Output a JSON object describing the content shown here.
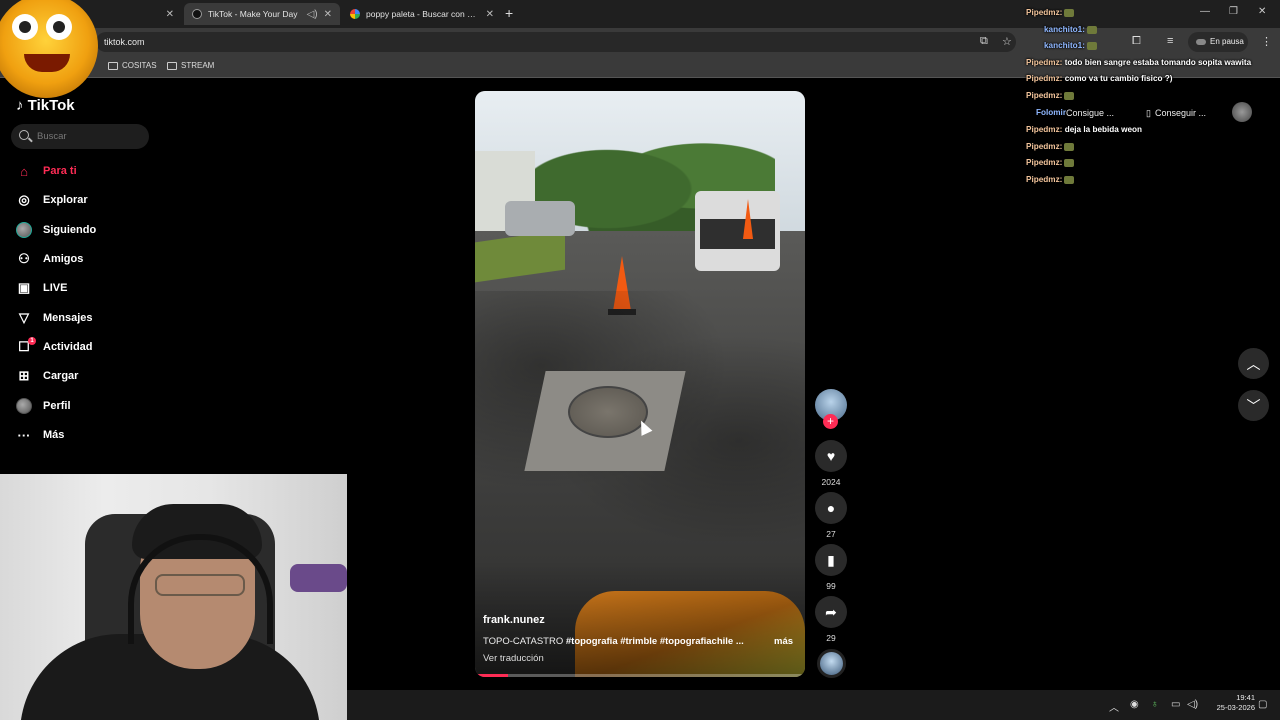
{
  "browser": {
    "tabs": [
      {
        "title": "",
        "active": false
      },
      {
        "title": "TikTok - Make Your Day",
        "active": true
      },
      {
        "title": "poppy paleta - Buscar con Goo",
        "active": false
      }
    ],
    "url": "tiktok.com",
    "media_pill": "En pausa",
    "bookmarks": [
      "COSITAS",
      "STREAM"
    ]
  },
  "sidebar": {
    "logo": "TikTok",
    "search_placeholder": "Buscar",
    "items": [
      {
        "label": "Para ti",
        "icon": "home-icon"
      },
      {
        "label": "Explorar",
        "icon": "compass-icon"
      },
      {
        "label": "Siguiendo",
        "icon": "avatar-icon"
      },
      {
        "label": "Amigos",
        "icon": "friends-icon"
      },
      {
        "label": "LIVE",
        "icon": "live-icon"
      },
      {
        "label": "Mensajes",
        "icon": "messages-icon"
      },
      {
        "label": "Actividad",
        "icon": "activity-icon",
        "badge": "1"
      },
      {
        "label": "Cargar",
        "icon": "upload-icon"
      },
      {
        "label": "Perfil",
        "icon": "profile-icon"
      },
      {
        "label": "Más",
        "icon": "more-icon"
      }
    ]
  },
  "video": {
    "author": "frank.nunez",
    "caption_prefix": "TOPO-CATASTRO",
    "hashtags": "#topografia #trimble #topografiachile ...",
    "more": "más",
    "translate": "Ver traducción",
    "progress": 0.1
  },
  "actions": {
    "likes": "2024",
    "comments": "27",
    "saves": "99",
    "shares": "29"
  },
  "topright": {
    "get1": "Consigue ...",
    "get2": "Conseguir ..."
  },
  "chat": [
    {
      "user": "Pipedmz:",
      "msg": "",
      "color": "orange"
    },
    {
      "user": "kanchito1:",
      "msg": "",
      "color": "blue"
    },
    {
      "user": "kanchito1:",
      "msg": "",
      "color": "blue"
    },
    {
      "user": "Pipedmz:",
      "msg": "todo bien sangre estaba tomando sopita wawita",
      "color": "orange"
    },
    {
      "user": "Pipedmz:",
      "msg": "como va tu cambio fisico ?)",
      "color": "orange"
    },
    {
      "user": "Pipedmz:",
      "msg": "",
      "color": "orange"
    },
    {
      "user": "Folomir",
      "msg": "",
      "color": "blue"
    },
    {
      "user": "Pipedmz:",
      "msg": "deja la bebida weon",
      "color": "orange"
    },
    {
      "user": "Pipedmz:",
      "msg": "",
      "color": "orange"
    },
    {
      "user": "Pipedmz:",
      "msg": "",
      "color": "orange"
    },
    {
      "user": "Pipedmz:",
      "msg": "",
      "color": "orange"
    }
  ],
  "taskbar": {
    "time": "19:41",
    "date": "25-03-2026"
  },
  "colors": {
    "accent": "#fe2c55",
    "background": "#000000"
  }
}
